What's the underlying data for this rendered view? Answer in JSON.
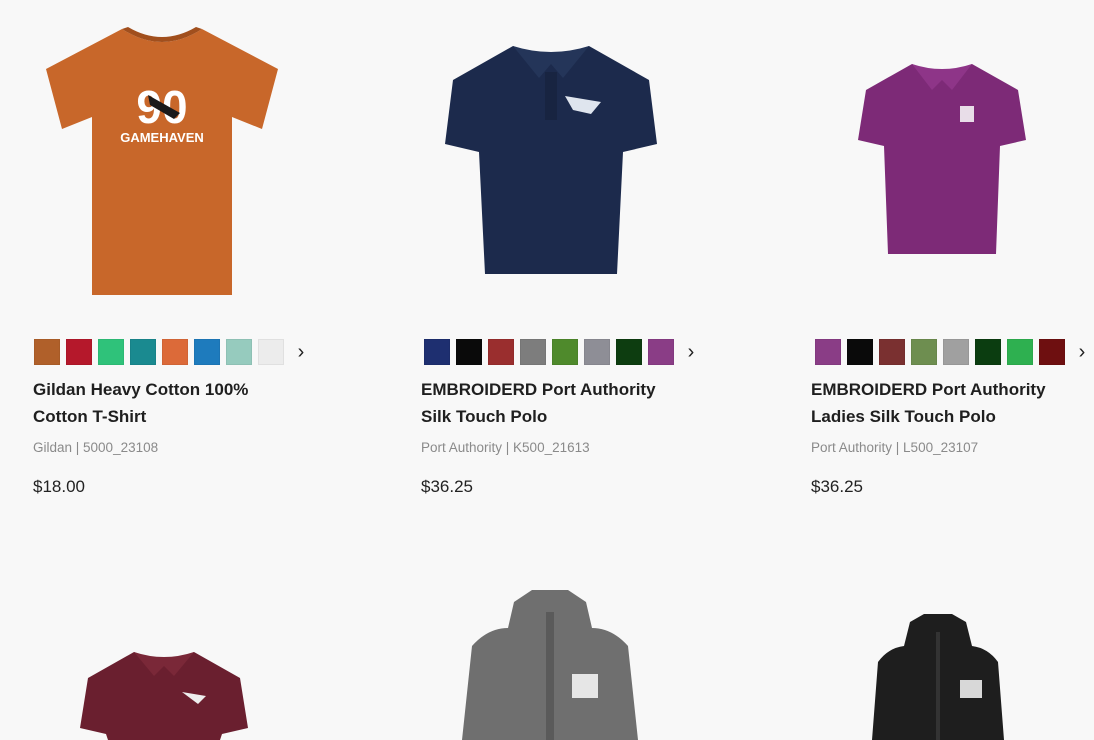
{
  "products": [
    {
      "title_line1": "Gildan Heavy Cotton 100%",
      "title_line2": "Cotton T-Shirt",
      "meta": "Gildan | 5000_23108",
      "price": "$18.00",
      "image_icon": "orange-t-shirt-image",
      "logo_text": "GAMEHAVEN",
      "logo_number": "90",
      "swatches": [
        "#b0602a",
        "#b5182b",
        "#2fc27a",
        "#1a8a90",
        "#dc6a39",
        "#1e7bbd",
        "#96cbbe",
        "#ececec"
      ]
    },
    {
      "title_line1": "EMBROIDERD Port Authority",
      "title_line2": "Silk Touch Polo",
      "meta": "Port Authority | K500_21613",
      "price": "$36.25",
      "image_icon": "navy-polo-image",
      "swatches": [
        "#1e2f70",
        "#0a0a0a",
        "#9a2e2e",
        "#7d7d7d",
        "#4f8a2c",
        "#8e8e96",
        "#0d3d10",
        "#8a3d86"
      ]
    },
    {
      "title_line1": "EMBROIDERD Port Authority",
      "title_line2": "Ladies Silk Touch Polo",
      "meta": "Port Authority | L500_23107",
      "price": "$36.25",
      "image_icon": "purple-polo-image",
      "swatches": [
        "#8a3d86",
        "#0a0a0a",
        "#7a3030",
        "#6e8e50",
        "#a0a0a0",
        "#0b3d10",
        "#2eb050",
        "#6e0f10"
      ]
    }
  ],
  "second_row": [
    {
      "image_icon": "maroon-polo-image"
    },
    {
      "image_icon": "gray-fleece-vest-image"
    },
    {
      "image_icon": "black-vest-image"
    }
  ],
  "chevron": "›"
}
